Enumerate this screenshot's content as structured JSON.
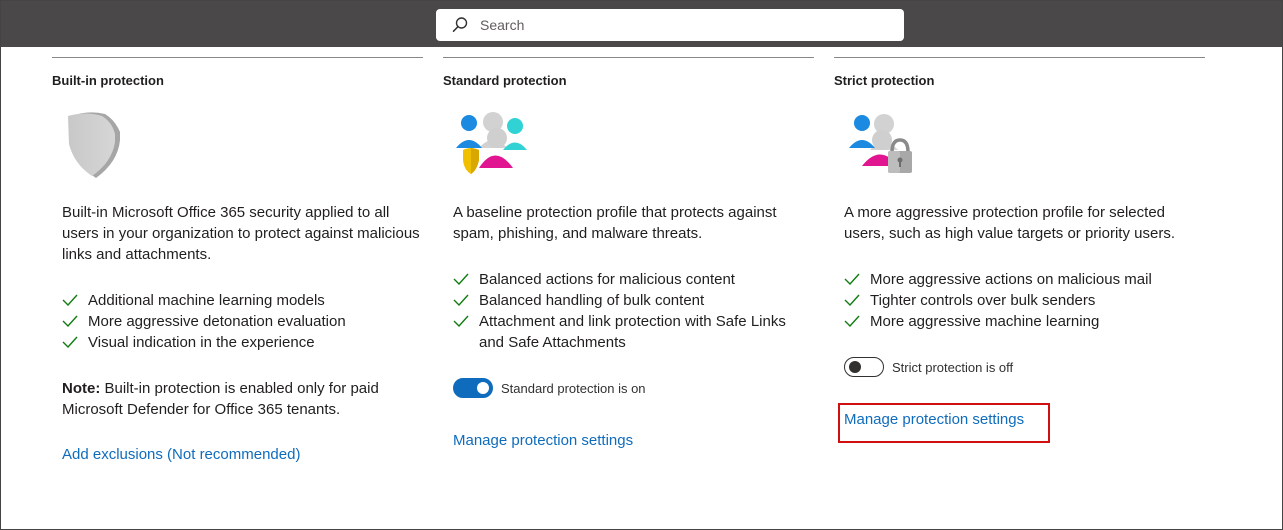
{
  "search": {
    "placeholder": "Search"
  },
  "columns": [
    {
      "title": "Built-in protection",
      "icon": "shield-icon",
      "description": "Built-in Microsoft Office 365 security applied to all users in your organization to protect against malicious links and attachments.",
      "features": [
        "Additional machine learning models",
        "More aggressive detonation evaluation",
        "Visual indication in the experience"
      ],
      "note_label": "Note:",
      "note_text": " Built-in protection is enabled only for paid Microsoft Defender for Office 365 tenants.",
      "link": "Add exclusions (Not recommended)"
    },
    {
      "title": "Standard protection",
      "icon": "users-shield-icon",
      "description": "A baseline protection profile that protects against spam, phishing, and malware threats.",
      "features": [
        "Balanced actions for malicious content",
        "Balanced handling of bulk content",
        "Attachment and link protection with Safe Links and Safe Attachments"
      ],
      "toggle": {
        "state": "on",
        "label": "Standard protection is on"
      },
      "link": "Manage protection settings"
    },
    {
      "title": "Strict protection",
      "icon": "users-lock-icon",
      "description": "A more aggressive protection profile for selected users, such as high value targets or priority users.",
      "features": [
        "More aggressive actions on malicious mail",
        "Tighter controls over bulk senders",
        "More aggressive machine learning"
      ],
      "toggle": {
        "state": "off",
        "label": "Strict protection is off"
      },
      "link": "Manage protection settings"
    }
  ],
  "colors": {
    "topbar": "#4a4848",
    "link": "#0f6cbd",
    "check": "#107c10",
    "highlight": "#d01010"
  }
}
